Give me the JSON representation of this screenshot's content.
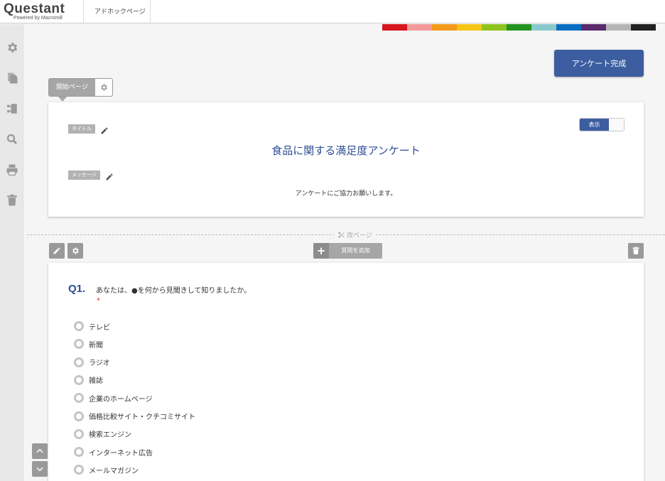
{
  "header": {
    "logo_text": "Questant",
    "logo_sub": "Powered by Macromill",
    "breadcrumb": "アドホックページ"
  },
  "color_palette": [
    "#d7171f",
    "#f29a9a",
    "#f39a1b",
    "#f6c516",
    "#8fc31f",
    "#22941f",
    "#89c9cb",
    "#0a6ec2",
    "#5a2a6c",
    "#b5b5b5",
    "#222222"
  ],
  "toolbar": {
    "complete_label": "アンケート完成"
  },
  "start_page": {
    "tab_label": "開始ページ",
    "title_tag": "タイトル",
    "title": "食品に関する満足度アンケート",
    "message_tag": "メッセージ",
    "message": "アンケートにご協力お願いします。",
    "toggle_label": "表示"
  },
  "page_break_label": "改ページ",
  "add_question_label": "質問を追加",
  "question": {
    "number": "Q1.",
    "text": "あなたは、●を何から見聞きして知りましたか。",
    "required_mark": "*",
    "options": [
      "テレビ",
      "新聞",
      "ラジオ",
      "雑誌",
      "企業のホームページ",
      "価格比較サイト・クチコミサイト",
      "検索エンジン",
      "インターネット広告",
      "メールマガジン"
    ]
  }
}
